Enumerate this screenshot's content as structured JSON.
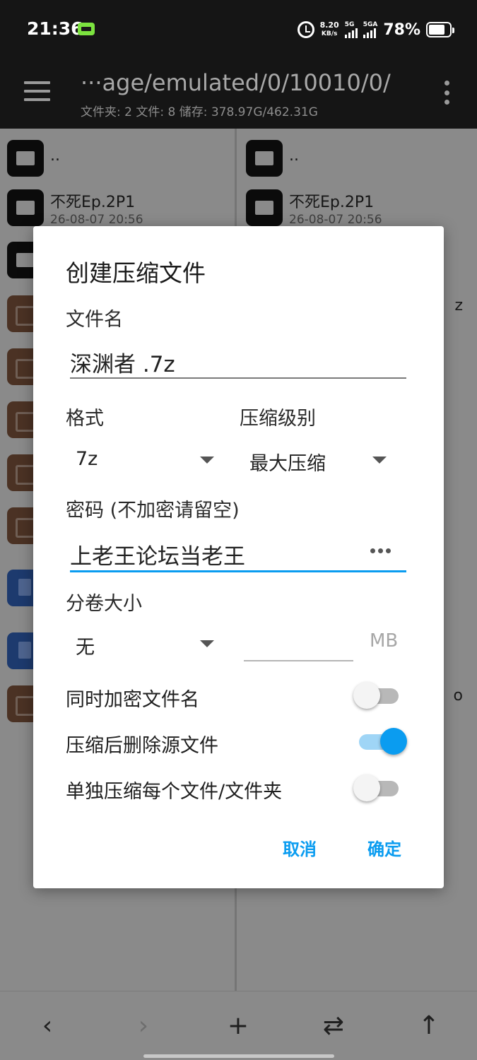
{
  "status": {
    "time": "21:36",
    "speed_value": "8.20",
    "speed_unit": "KB/s",
    "net1": "5G",
    "net2": "5GA",
    "battery_pct": "78%",
    "battery_level": 0.78
  },
  "appbar": {
    "path": "···age/emulated/0/10010/0/",
    "info": "文件夹: 2  文件: 8  储存: 378.97G/462.31G"
  },
  "left_pane": {
    "items": [
      {
        "type": "folder",
        "name": "..",
        "date": ""
      },
      {
        "type": "folder",
        "name": "不死Ep.2P1",
        "date": "26-08-07 20:56"
      },
      {
        "type": "folder",
        "name": "",
        "date": ""
      },
      {
        "type": "archive",
        "name": "",
        "date": ""
      },
      {
        "type": "archive",
        "name": "",
        "date": ""
      },
      {
        "type": "archive",
        "name": "",
        "date": ""
      },
      {
        "type": "archive",
        "name": "",
        "date": ""
      },
      {
        "type": "archive",
        "name": "",
        "date": ""
      },
      {
        "type": "doc",
        "name": "",
        "date": ""
      },
      {
        "type": "doc",
        "name": "",
        "date": ""
      },
      {
        "type": "archive",
        "name": "",
        "date": ""
      }
    ]
  },
  "right_pane": {
    "items": [
      {
        "type": "folder",
        "name": "..",
        "date": ""
      },
      {
        "type": "folder",
        "name": "不死Ep.2P1",
        "date": "26-08-07 20:56"
      }
    ],
    "trail1": "z",
    "trail2": "o"
  },
  "dialog": {
    "title": "创建压缩文件",
    "filename_label": "文件名",
    "filename_value": "深渊者 .7z",
    "format_label": "格式",
    "format_value": "7z",
    "level_label": "压缩级别",
    "level_value": "最大压缩",
    "password_label": "密码 (不加密请留空)",
    "password_value": "上老王论坛当老王",
    "split_label": "分卷大小",
    "split_value": "无",
    "split_unit": "MB",
    "toggles": [
      {
        "label": "同时加密文件名",
        "on": false
      },
      {
        "label": "压缩后删除源文件",
        "on": true
      },
      {
        "label": "单独压缩每个文件/文件夹",
        "on": false
      }
    ],
    "cancel": "取消",
    "confirm": "确定"
  },
  "bottombar": {
    "back_icon": "‹",
    "forward_icon": "›",
    "add_icon": "+",
    "swap_icon": "⇄",
    "up_icon": "↑"
  }
}
